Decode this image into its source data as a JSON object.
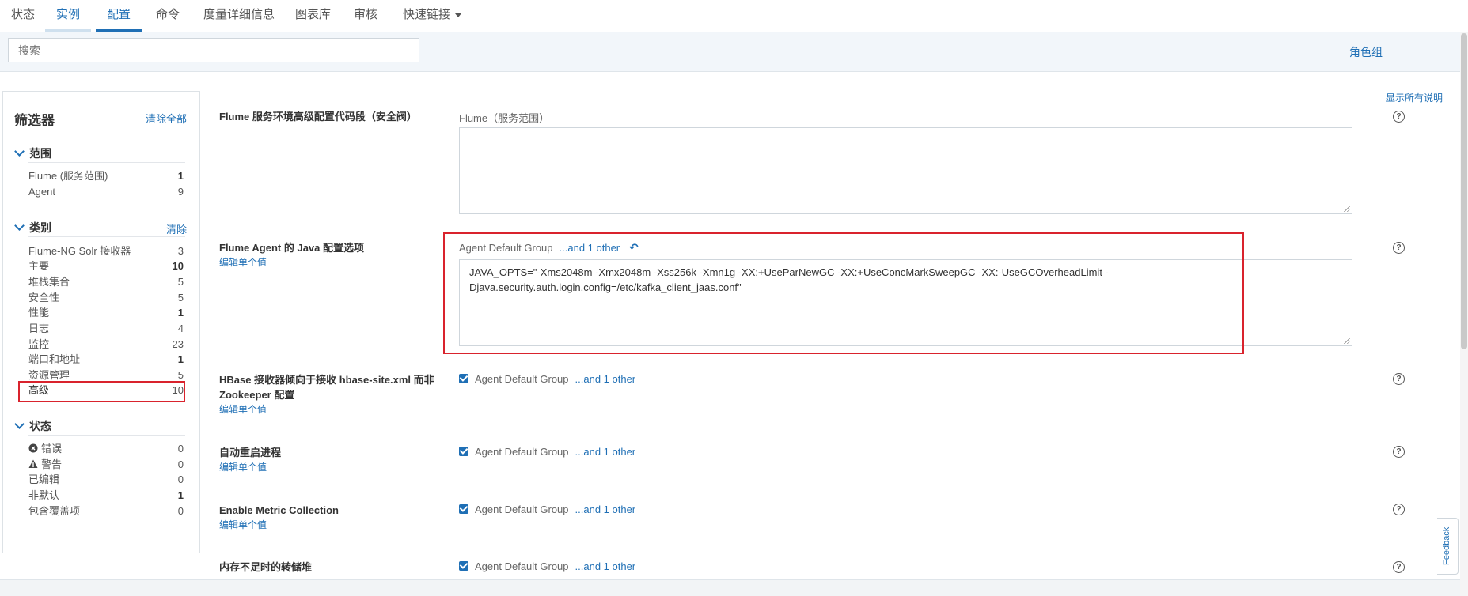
{
  "nav": {
    "tabs": [
      {
        "label": "状态"
      },
      {
        "label": "实例"
      },
      {
        "label": "配置"
      },
      {
        "label": "命令"
      },
      {
        "label": "度量详细信息"
      },
      {
        "label": "图表库"
      },
      {
        "label": "审核"
      },
      {
        "label": "快速链接"
      }
    ]
  },
  "search": {
    "placeholder": "搜索"
  },
  "role_group_label": "角色组",
  "filter": {
    "title": "筛选器",
    "clear_all": "清除全部",
    "scope": {
      "title": "范围",
      "items": [
        {
          "label": "Flume (服务范围)",
          "count": "1"
        },
        {
          "label": "Agent",
          "count": "9"
        }
      ]
    },
    "category": {
      "title": "类别",
      "clear": "清除",
      "items": [
        {
          "label": "Flume-NG Solr 接收器",
          "count": "3"
        },
        {
          "label": "主要",
          "count": "10"
        },
        {
          "label": "堆栈集合",
          "count": "5"
        },
        {
          "label": "安全性",
          "count": "5"
        },
        {
          "label": "性能",
          "count": "1"
        },
        {
          "label": "日志",
          "count": "4"
        },
        {
          "label": "监控",
          "count": "23"
        },
        {
          "label": "端口和地址",
          "count": "1"
        },
        {
          "label": "资源管理",
          "count": "5"
        },
        {
          "label": "高级",
          "count": "10"
        }
      ]
    },
    "status": {
      "title": "状态",
      "items": [
        {
          "label": "错误",
          "count": "0",
          "icon": "error-icon"
        },
        {
          "label": "警告",
          "count": "0",
          "icon": "warning-icon"
        },
        {
          "label": "已编辑",
          "count": "0"
        },
        {
          "label": "非默认",
          "count": "1"
        },
        {
          "label": "包含覆盖项",
          "count": "0"
        }
      ]
    }
  },
  "main": {
    "show_all_desc": "显示所有说明",
    "edit_single": "编辑单个值",
    "rows": [
      {
        "label": "Flume 服务环境高级配置代码段（安全阀）",
        "scope": "Flume（服务范围）",
        "value": ""
      },
      {
        "label": "Flume Agent 的 Java 配置选项",
        "group": "Agent Default Group",
        "other": "...and 1 other",
        "value": "JAVA_OPTS=\"-Xms2048m -Xmx2048m -Xss256k -Xmn1g -XX:+UseParNewGC -XX:+UseConcMarkSweepGC -XX:-UseGCOverheadLimit -Djava.security.auth.login.config=/etc/kafka_client_jaas.conf\""
      },
      {
        "label": "HBase 接收器倾向于接收 hbase-site.xml 而非 Zookeeper 配置",
        "group": "Agent Default Group",
        "other": "...and 1 other"
      },
      {
        "label": "自动重启进程",
        "group": "Agent Default Group",
        "other": "...and 1 other"
      },
      {
        "label": "Enable Metric Collection",
        "group": "Agent Default Group",
        "other": "...and 1 other"
      },
      {
        "label": "内存不足时的转储堆",
        "group": "Agent Default Group",
        "other": "...and 1 other"
      }
    ]
  },
  "feedback_label": "Feedback"
}
